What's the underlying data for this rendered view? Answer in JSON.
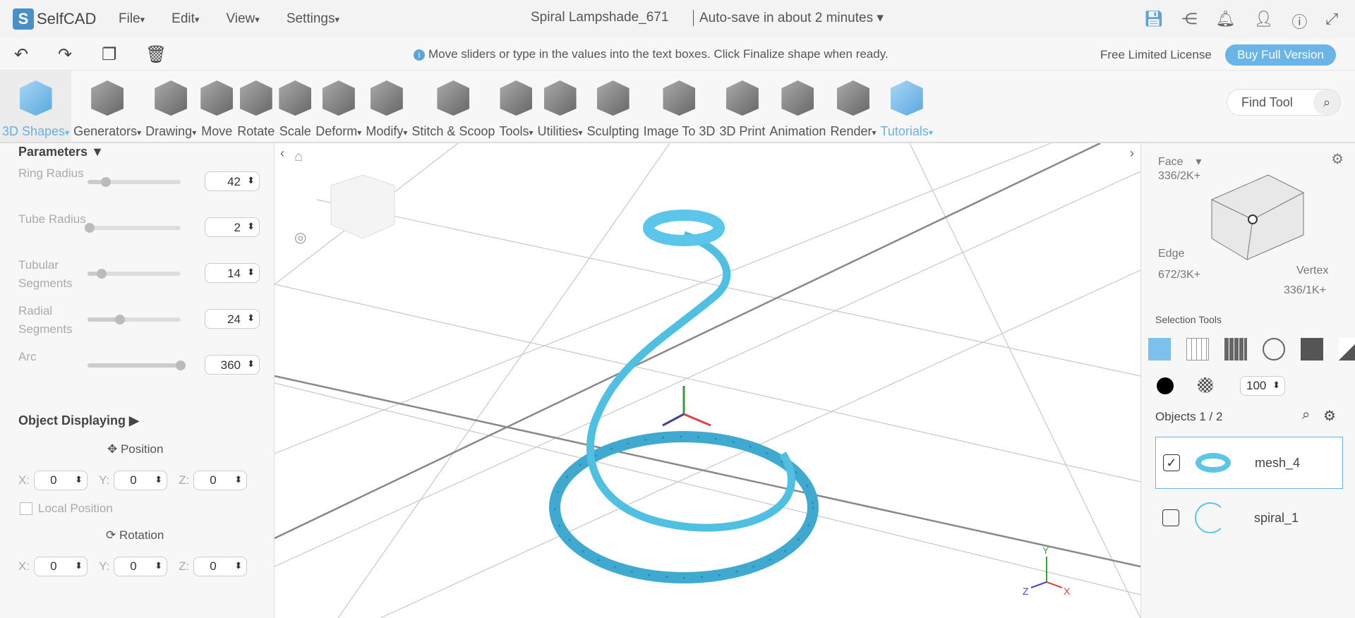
{
  "app": {
    "logo": "SelfCAD",
    "menus": [
      "File",
      "Edit",
      "View",
      "Settings"
    ],
    "title": "Spiral Lampshade_671",
    "autosave": "Auto-save in about 2 minutes ▾"
  },
  "bar2": {
    "hint": "Move sliders or type in the values into the text boxes. Click Finalize shape when ready.",
    "license": "Free Limited License",
    "buy": "Buy Full Version"
  },
  "toolbar": {
    "tools": [
      {
        "label": "3D Shapes",
        "dd": true
      },
      {
        "label": "Generators",
        "dd": true
      },
      {
        "label": "Drawing",
        "dd": true
      },
      {
        "label": "Move"
      },
      {
        "label": "Rotate"
      },
      {
        "label": "Scale"
      },
      {
        "label": "Deform",
        "dd": true
      },
      {
        "label": "Modify",
        "dd": true
      },
      {
        "label": "Stitch & Scoop"
      },
      {
        "label": "Tools",
        "dd": true
      },
      {
        "label": "Utilities",
        "dd": true
      },
      {
        "label": "Sculpting"
      },
      {
        "label": "Image To 3D"
      },
      {
        "label": "3D Print"
      },
      {
        "label": "Animation"
      },
      {
        "label": "Render",
        "dd": true
      },
      {
        "label": "Tutorials",
        "dd": true
      }
    ],
    "find_placeholder": "Find Tool"
  },
  "parameters": {
    "title": "Parameters ▼",
    "items": [
      {
        "label": "Ring Radius",
        "value": "42",
        "fraction": 0.2
      },
      {
        "label": "Tube Radius",
        "value": "2",
        "fraction": 0.02
      },
      {
        "label": "Tubular Segments",
        "value": "14",
        "fraction": 0.15
      },
      {
        "label": "Radial Segments",
        "value": "24",
        "fraction": 0.35
      },
      {
        "label": "Arc",
        "value": "360",
        "fraction": 1.0
      }
    ]
  },
  "display": {
    "title": "Object Displaying ▶",
    "position": "✥ Position",
    "local": "Local Position",
    "rotation": "⟳ Rotation",
    "axes": [
      "X:",
      "Y:",
      "Z:"
    ],
    "pos": [
      "0",
      "0",
      "0"
    ],
    "rot": [
      "0",
      "0",
      "0"
    ]
  },
  "right": {
    "face": "Face",
    "face_count": "336/2K+",
    "edge": "Edge",
    "edge_count": "672/3K+",
    "vertex": "Vertex",
    "vertex_count": "336/1K+",
    "selection_tools": "Selection Tools",
    "opacity": "100",
    "objects_label": "Objects 1 / 2",
    "objects": [
      {
        "name": "mesh_4",
        "checked": true
      },
      {
        "name": "spiral_1",
        "checked": false
      }
    ]
  },
  "axes": {
    "x": "X",
    "y": "Y",
    "z": "Z"
  }
}
